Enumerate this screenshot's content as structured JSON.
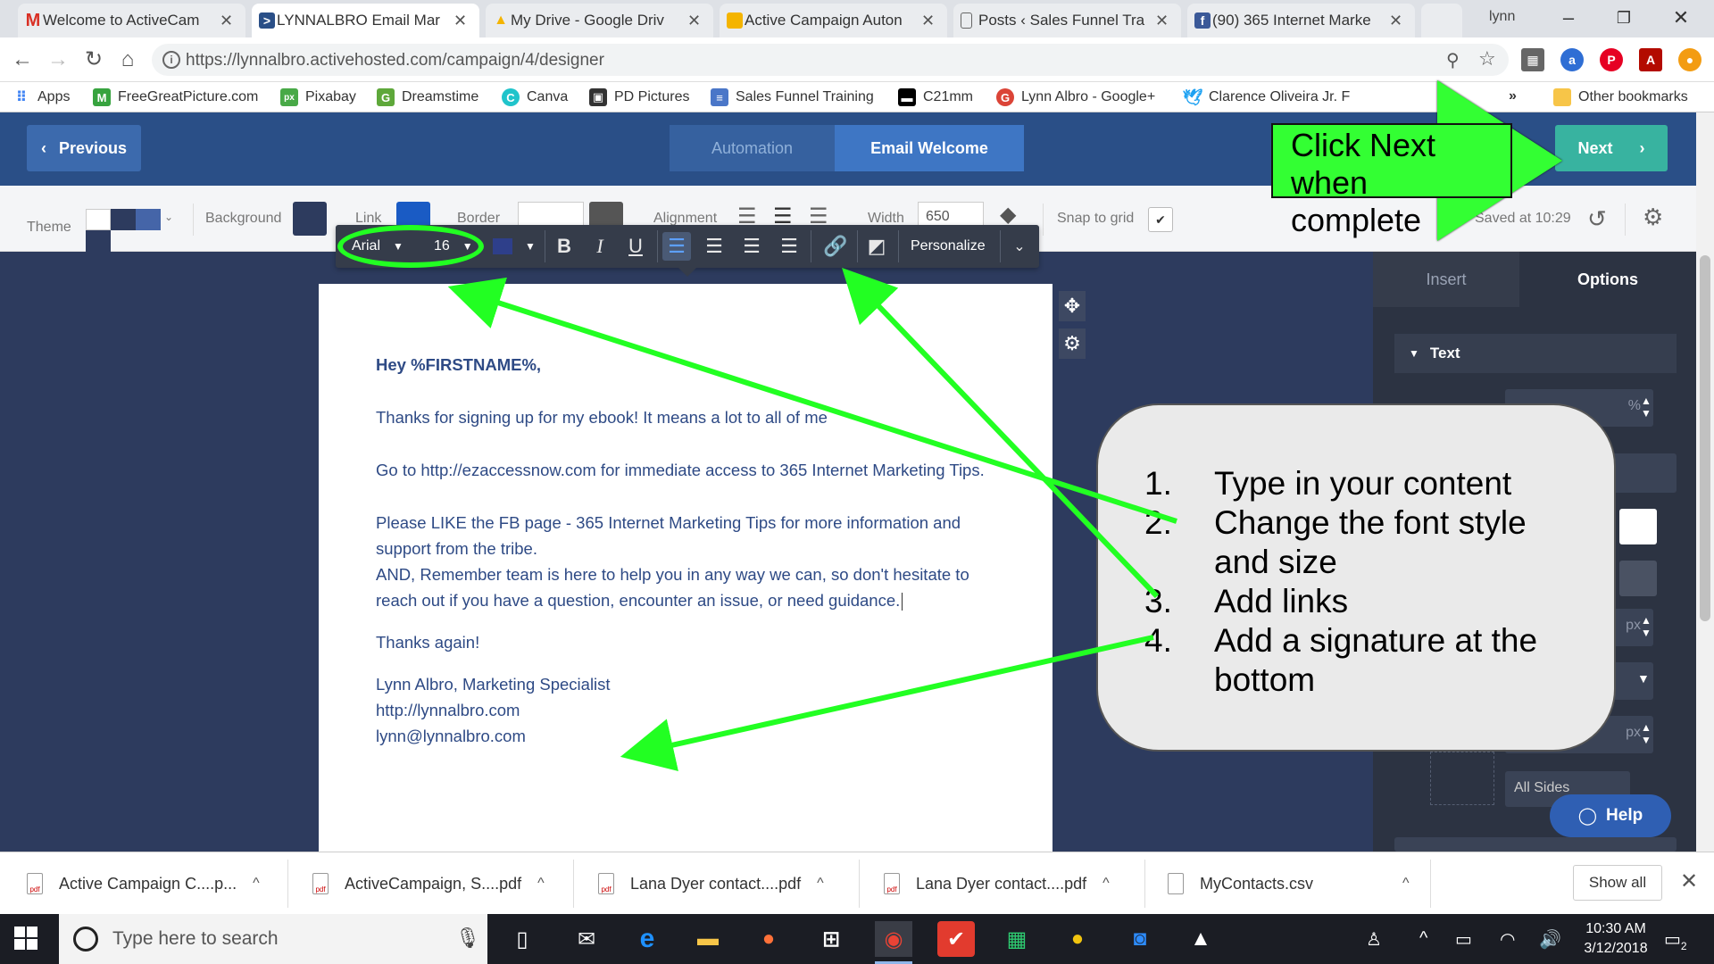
{
  "browser": {
    "tabs": [
      {
        "label": "Welcome to ActiveCam",
        "icon": "gmail-icon",
        "active": false
      },
      {
        "label": "LYNNALBRO Email Mar",
        "icon": "activecampaign-icon",
        "active": true
      },
      {
        "label": "My Drive - Google Driv",
        "icon": "google-drive-icon",
        "active": false
      },
      {
        "label": "Active Campaign Auton",
        "icon": "google-slides-icon",
        "active": false
      },
      {
        "label": "Posts ‹ Sales Funnel Tra",
        "icon": "page-icon",
        "active": false
      },
      {
        "label": "(90) 365 Internet Marke",
        "icon": "facebook-icon",
        "active": false
      }
    ],
    "user": "lynn",
    "url": "https://lynnalbro.activehosted.com/campaign/4/designer",
    "bookmarks": [
      "Apps",
      "FreeGreatPicture.com",
      "Pixabay",
      "Dreamstime",
      "Canva",
      "PD Pictures",
      "Sales Funnel Training",
      "C21mm",
      "Lynn Albro - Google+",
      "Clarence Oliveira Jr. F",
      "»",
      "Other bookmarks"
    ]
  },
  "header": {
    "previous_label": "Previous",
    "steps": [
      "Automation",
      "Email Welcome"
    ],
    "next_label": "Next"
  },
  "options_bar": {
    "theme_label": "Theme",
    "background_label": "Background",
    "link_label": "Link",
    "border_label": "Border",
    "alignment_label": "Alignment",
    "width_label": "Width",
    "width_value": "650",
    "snap_label": "Snap to grid",
    "saved_label": "Saved at 10:29",
    "colors": {
      "background_swatch": "#2d3b5e",
      "link_swatch": "#1a5bc4",
      "border_swatch": "#555555"
    }
  },
  "format_toolbar": {
    "font": "Arial",
    "size": "16",
    "personalize_label": "Personalize"
  },
  "email": {
    "greeting": "Hey %FIRSTNAME%,",
    "para1": "Thanks for signing up for my ebook! It means a lot to all of me",
    "para2": "Go to http://ezaccessnow.com for immediate access to 365 Internet Marketing Tips.",
    "para3a": "Please LIKE the FB page - 365 Internet Marketing Tips for more information and support from the tribe.",
    "para3b": "AND, Remember team is here to help you in any way we can, so don't hesitate to reach out if you have a question, encounter an issue, or need guidance.",
    "closing": "Thanks again!",
    "sig_name": "Lynn Albro, Marketing Specialist",
    "sig_url": "http://lynnalbro.com",
    "sig_email": "lynn@lynnalbro.com"
  },
  "right_panel": {
    "tabs": [
      "Insert",
      "Options"
    ],
    "section_title": "Text",
    "field_unit": "%",
    "px_label": "px",
    "all_sides_label": "All Sides",
    "help_label": "Help"
  },
  "annotations": {
    "next_callout": [
      "Click Next",
      "when complete"
    ],
    "steps": [
      {
        "num": "1.",
        "text": "Type in your content"
      },
      {
        "num": "2.",
        "text": "Change the font style and size"
      },
      {
        "num": "3.",
        "text": "Add links"
      },
      {
        "num": "4.",
        "text": "Add a signature at the bottom"
      }
    ],
    "color": "#33ff33"
  },
  "downloads": {
    "items": [
      "Active Campaign C....p...",
      "ActiveCampaign, S....pdf",
      "Lana Dyer contact....pdf",
      "Lana Dyer contact....pdf",
      "MyContacts.csv"
    ],
    "show_all": "Show all"
  },
  "taskbar": {
    "search_placeholder": "Type here to search",
    "time": "10:30 AM",
    "date": "3/12/2018",
    "notifications": "2"
  }
}
